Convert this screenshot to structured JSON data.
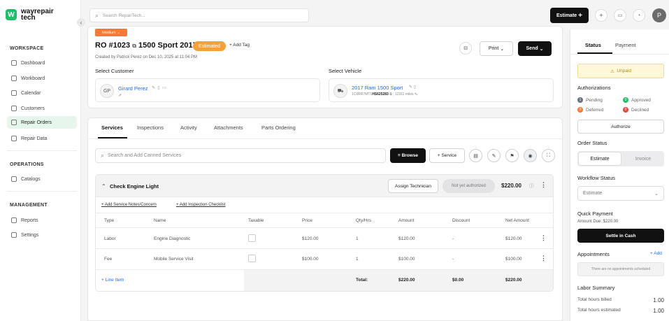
{
  "brand": {
    "name_line1": "wayrepair",
    "name_line2": "tech"
  },
  "sidebar": {
    "workspace_title": "WORKSPACE",
    "workspace": [
      {
        "label": "Dashboard"
      },
      {
        "label": "Workboard"
      },
      {
        "label": "Calendar"
      },
      {
        "label": "Customers"
      },
      {
        "label": "Repair Orders"
      },
      {
        "label": "Repair Data"
      }
    ],
    "operations_title": "OPERATIONS",
    "operations": [
      {
        "label": "Catalogs"
      }
    ],
    "management_title": "MANAGEMENT",
    "management": [
      {
        "label": "Reports"
      },
      {
        "label": "Settings"
      }
    ]
  },
  "topbar": {
    "search_placeholder": "Search RepairTech...",
    "estimate_label": "Estimate",
    "avatar_initial": "P"
  },
  "ro": {
    "priority": "Medium",
    "number": "RO #1023",
    "vehicle_title": "1500 Sport 2017",
    "status": "Estimated",
    "add_tag": "+ Add Tag",
    "created": "Created by Patrick Perez on Dec 10, 2025 at 11:04 PM",
    "print_label": "Print",
    "send_label": "Send"
  },
  "customer": {
    "label": "Select Customer",
    "initials": "GP",
    "name": "Girard Perez"
  },
  "vehicle": {
    "label": "Select Vehicle",
    "name": "2017 Ram 1500 Sport",
    "vin_prefix": "1C6RR7MT1",
    "vin_suffix": "HS625283",
    "miles": "12311 miles"
  },
  "tabs": [
    {
      "label": "Services"
    },
    {
      "label": "Inspections"
    },
    {
      "label": "Activity"
    },
    {
      "label": "Attachments"
    },
    {
      "label": "Parts Ordering"
    }
  ],
  "services": {
    "search_placeholder": "Search and Add Canned Services",
    "browse_label": "Browse",
    "service_label": "Service"
  },
  "job": {
    "title": "Check Engine Light",
    "assign_label": "Assign Technician",
    "auth_status": "Not yet authorized",
    "total": "$220.00",
    "add_notes": "Add Service Notes/Concern",
    "add_checklist": "Add Inspection Checklist",
    "columns": [
      "Type",
      "Name",
      "Taxable",
      "Price",
      "Qty/Hrs",
      "Amount",
      "Discount",
      "Net Amount"
    ],
    "rows": [
      {
        "type": "Labor",
        "name": "Engine Diagnostic",
        "price": "$120.00",
        "qty": "1",
        "amount": "$120.00",
        "discount": "-",
        "net": "$120.00"
      },
      {
        "type": "Fee",
        "name": "Mobile Service Visit",
        "price": "$100.00",
        "qty": "1",
        "amount": "$100.00",
        "discount": "-",
        "net": "$100.00"
      }
    ],
    "line_item": "+ Line Item",
    "total_label": "Total:",
    "total_amount": "$220.00",
    "total_discount": "$0.00",
    "total_net": "$220.00"
  },
  "right": {
    "tab_status": "Status",
    "tab_payment": "Payment",
    "unpaid": "Unpaid",
    "authorizations_title": "Authorizations",
    "auth": [
      {
        "label": "Pending",
        "count": "1",
        "color": "#6b7280"
      },
      {
        "label": "Approved",
        "count": "0",
        "color": "#1fbf6a"
      },
      {
        "label": "Deferred",
        "count": "0",
        "color": "#f47a36"
      },
      {
        "label": "Declined",
        "count": "0",
        "color": "#e5483b"
      }
    ],
    "authorize_label": "Authorize",
    "order_status_title": "Order Status",
    "seg_estimate": "Estimate",
    "seg_invoice": "Invoice",
    "workflow_title": "Workflow Status",
    "workflow_value": "Estimate",
    "quick_payment_title": "Quick Payment",
    "amount_due": "Amount Due: $220.00",
    "settle_label": "Settle in Cash",
    "appointments_title": "Appointments",
    "add_appt": "+ Add",
    "no_appts": "There are no appointments scheduled",
    "labor_title": "Labor Summary",
    "labor_rows": [
      {
        "label": "Total hours billed",
        "value": "1.00"
      },
      {
        "label": "Total hours estimated",
        "value": "1.00"
      }
    ]
  }
}
